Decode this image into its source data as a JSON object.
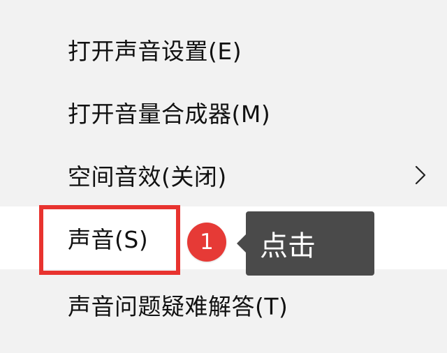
{
  "context_menu": {
    "items": [
      {
        "label": "打开声音设置(E)",
        "has_submenu": false
      },
      {
        "label": "打开音量合成器(M)",
        "has_submenu": false
      },
      {
        "label": "空间音效(关闭)",
        "has_submenu": true
      },
      {
        "label": "声音(S)",
        "has_submenu": false,
        "highlighted": true
      },
      {
        "label": "声音问题疑难解答(T)",
        "has_submenu": false
      }
    ],
    "submenu_icon": "chevron-right-icon"
  },
  "annotation": {
    "step_number": "1",
    "tooltip_text": "点击",
    "colors": {
      "highlight_border": "#e8332f",
      "badge": "#e63a36",
      "tooltip_bg": "#4a4a4a"
    }
  }
}
